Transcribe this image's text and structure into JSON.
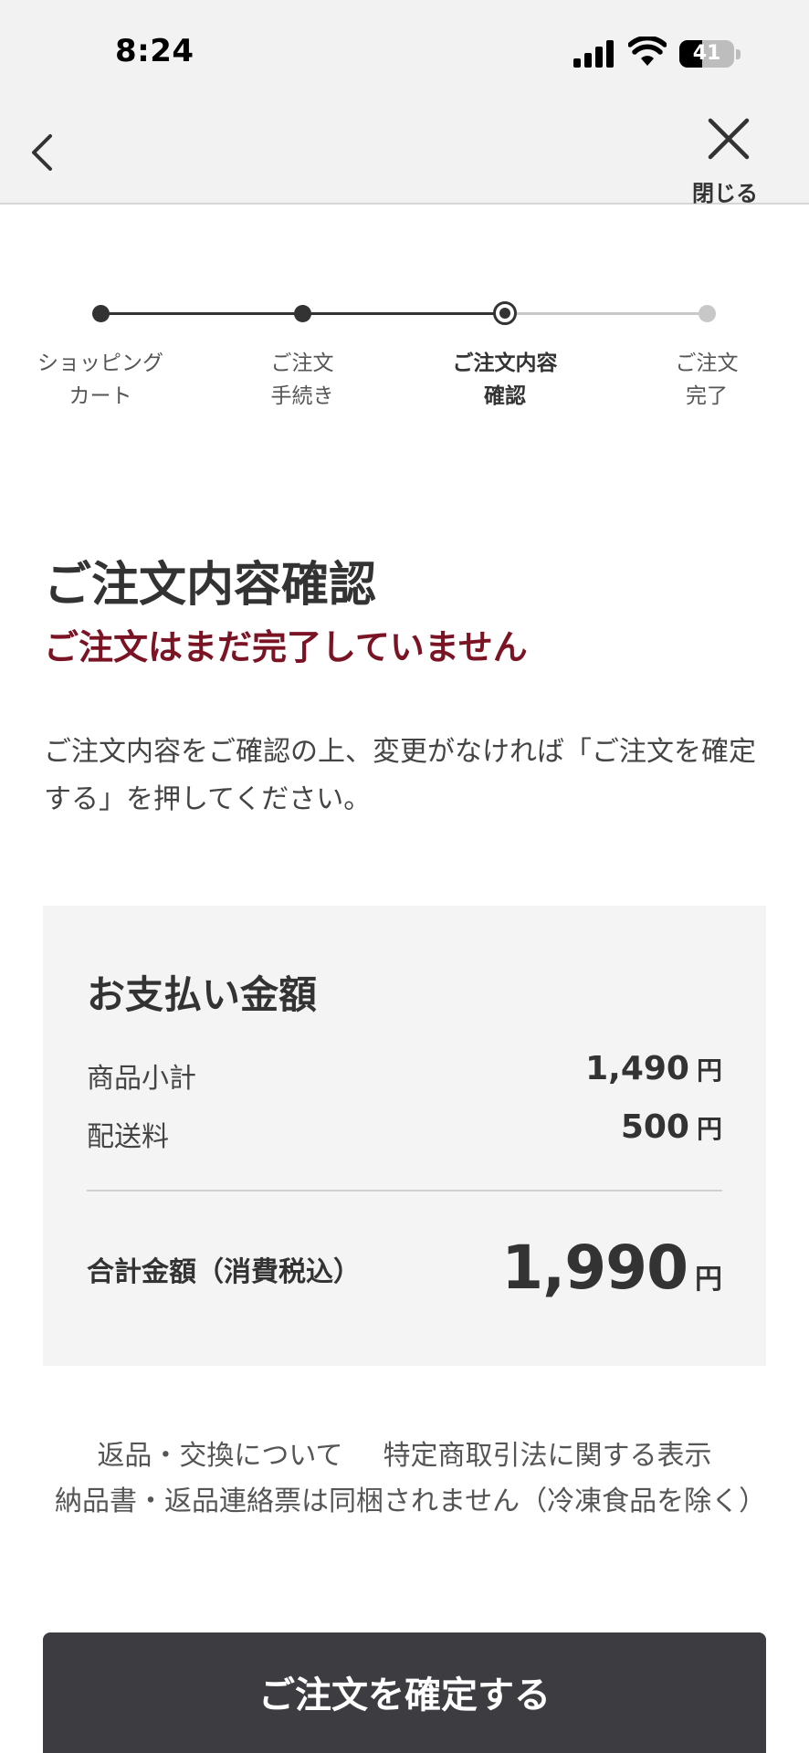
{
  "status_bar": {
    "time": "8:24",
    "battery_percent": "41",
    "battery_level": 0.41
  },
  "nav": {
    "back_icon": "chevron-left-icon",
    "close_icon": "close-icon",
    "close_label": "閉じる"
  },
  "steps": [
    {
      "label": "ショッピング\nカート",
      "state": "done"
    },
    {
      "label": "ご注文\n手続き",
      "state": "done"
    },
    {
      "label": "ご注文内容\n確認",
      "state": "current"
    },
    {
      "label": "ご注文\n完了",
      "state": "todo"
    }
  ],
  "page": {
    "title": "ご注文内容確認",
    "warning": "ご注文はまだ完了していません",
    "instructions": "ご注文内容をご確認の上、変更がなければ「ご注文を確定する」を押してください。"
  },
  "payment": {
    "title": "お支払い金額",
    "currency": "円",
    "subtotal_label": "商品小計",
    "subtotal_value": "1,490",
    "shipping_label": "配送料",
    "shipping_value": "500",
    "total_label": "合計金額（消費税込）",
    "total_value": "1,990"
  },
  "links": {
    "returns": "返品・交換について",
    "legal": "特定商取引法に関する表示",
    "note": "納品書・返品連絡票は同梱されません（冷凍食品を除く）"
  },
  "confirm_button": {
    "label": "ご注文を確定する"
  },
  "colors": {
    "warning": "#7a1424",
    "button": "#3c3c41",
    "panel": "#f4f4f4"
  }
}
